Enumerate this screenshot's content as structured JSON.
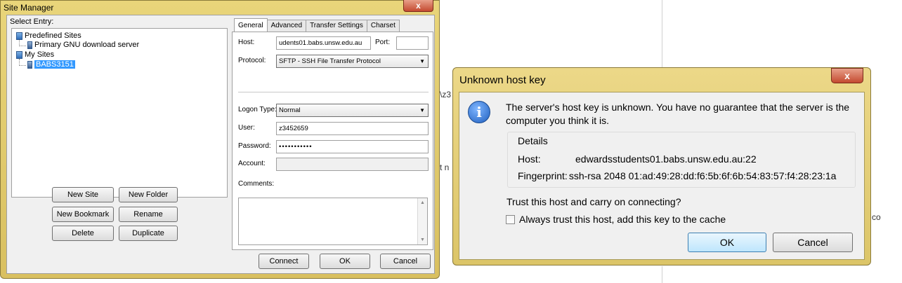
{
  "site_manager": {
    "title": "Site Manager",
    "close_glyph": "x",
    "select_entry_label": "Select Entry:",
    "tree": [
      {
        "label": "Predefined Sites",
        "type": "folder"
      },
      {
        "label": "Primary GNU download server",
        "type": "server"
      },
      {
        "label": "My Sites",
        "type": "folder"
      },
      {
        "label": "BABS3151",
        "type": "server",
        "selected": true
      }
    ],
    "buttons": {
      "new_site": "New Site",
      "new_folder": "New Folder",
      "new_bookmark": "New Bookmark",
      "rename": "Rename",
      "delete": "Delete",
      "duplicate": "Duplicate"
    },
    "tabs": [
      "General",
      "Advanced",
      "Transfer Settings",
      "Charset"
    ],
    "general": {
      "host_label": "Host:",
      "host_value": "udents01.babs.unsw.edu.au",
      "port_label": "Port:",
      "port_value": "",
      "protocol_label": "Protocol:",
      "protocol_value": "SFTP - SSH File Transfer Protocol",
      "logon_type_label": "Logon Type:",
      "logon_type_value": "Normal",
      "user_label": "User:",
      "user_value": "z3452659",
      "password_label": "Password:",
      "password_value": "•••••••••••",
      "account_label": "Account:",
      "account_value": "",
      "comments_label": "Comments:"
    },
    "footer_buttons": {
      "connect": "Connect",
      "ok": "OK",
      "cancel": "Cancel"
    }
  },
  "background": {
    "frag1": "\\z3",
    "frag2": "t n",
    "frag3": "co"
  },
  "host_key_dialog": {
    "title": "Unknown host key",
    "close_glyph": "x",
    "message": "The server's host key is unknown. You have no guarantee that the server is the computer you think it is.",
    "details_title": "Details",
    "host_label": "Host:",
    "host_value": "edwardsstudents01.babs.unsw.edu.au:22",
    "fingerprint_label": "Fingerprint:",
    "fingerprint_value": "ssh-rsa 2048 01:ad:49:28:dd:f6:5b:6f:6b:54:83:57:f4:28:23:1a",
    "question": "Trust this host and carry on connecting?",
    "checkbox_label": "Always trust this host, add this key to the cache",
    "checkbox_checked": false,
    "ok": "OK",
    "cancel": "Cancel"
  }
}
